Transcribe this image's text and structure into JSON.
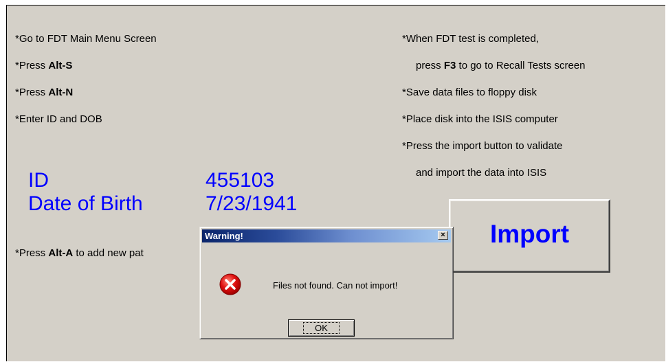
{
  "left_instructions": [
    {
      "star": "*",
      "pre": "Go to FDT Main Menu Screen",
      "key": "",
      "post": ""
    },
    {
      "star": "*",
      "pre": "Press ",
      "key": "Alt-S",
      "post": ""
    },
    {
      "star": "*",
      "pre": "Press ",
      "key": "Alt-N",
      "post": ""
    },
    {
      "star": "*",
      "pre": "Enter ID and DOB",
      "key": "",
      "post": ""
    }
  ],
  "right_instructions": [
    {
      "star": "*",
      "pre": "When FDT test is completed,",
      "key": "",
      "post": ""
    },
    {
      "star": "",
      "pre": "press ",
      "key": "F3",
      "post": " to go to Recall Tests screen"
    },
    {
      "star": "*",
      "pre": "Save data files to floppy disk",
      "key": "",
      "post": ""
    },
    {
      "star": "*",
      "pre": "Place disk into the ISIS computer",
      "key": "",
      "post": ""
    },
    {
      "star": "*",
      "pre": "Press the import button to validate",
      "key": "",
      "post": ""
    },
    {
      "star": "",
      "pre": "and import the data into ISIS",
      "key": "",
      "post": ""
    }
  ],
  "add_patient": {
    "star": "*",
    "pre": "Press ",
    "key": "Alt-A",
    "post": " to add new pat"
  },
  "patient": {
    "id_label": "ID",
    "id_value": "455103",
    "dob_label": "Date of Birth",
    "dob_value": "7/23/1941"
  },
  "import_button": {
    "label": "Import"
  },
  "dialog": {
    "title": "Warning!",
    "close_glyph": "×",
    "message": "Files not found. Can not import!",
    "ok_label": "OK",
    "icon": "error-icon"
  },
  "colors": {
    "background": "#d4d0c8",
    "accent_text": "#0000ff",
    "titlebar_start": "#0a246a",
    "titlebar_end": "#a6caf0",
    "error_red": "#e01010"
  }
}
